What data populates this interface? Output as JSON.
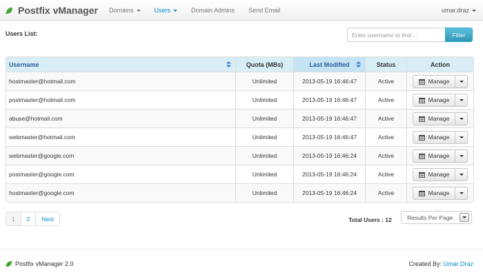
{
  "navbar": {
    "brand": "Postfix vManager",
    "items": [
      {
        "label": "Domains",
        "dropdown": true,
        "active": false
      },
      {
        "label": "Users",
        "dropdown": true,
        "active": true
      },
      {
        "label": "Domain Admins",
        "dropdown": false,
        "active": false
      },
      {
        "label": "Send Email",
        "dropdown": false,
        "active": false
      }
    ],
    "user": "umar.draz"
  },
  "list_title": "Users List:",
  "search": {
    "placeholder": "Enter username to find ...",
    "value": "",
    "button_label": "Filter"
  },
  "table": {
    "columns": [
      "Username",
      "Quota (MBs)",
      "Last Modified",
      "Status",
      "Action"
    ],
    "rows": [
      {
        "username": "hostmaster@hotmail.com",
        "quota": "Unlimited",
        "modified": "2013-05-19 16:46:47",
        "status": "Active",
        "action": "Manage"
      },
      {
        "username": "postmaster@hotmail.com",
        "quota": "Unlimited",
        "modified": "2013-05-19 16:46:47",
        "status": "Active",
        "action": "Manage"
      },
      {
        "username": "abuse@hotmail.com",
        "quota": "Unlimited",
        "modified": "2013-05-19 16:46:47",
        "status": "Active",
        "action": "Manage"
      },
      {
        "username": "webmaster@hotmail.com",
        "quota": "Unlimited",
        "modified": "2013-05-19 16:46:47",
        "status": "Active",
        "action": "Manage"
      },
      {
        "username": "webmaster@google.com",
        "quota": "Unlimited",
        "modified": "2013-05-19 16:46:24",
        "status": "Active",
        "action": "Manage"
      },
      {
        "username": "postmaster@google.com",
        "quota": "Unlimited",
        "modified": "2013-05-19 16:46:24",
        "status": "Active",
        "action": "Manage"
      },
      {
        "username": "hostmaster@google.com",
        "quota": "Unlimited",
        "modified": "2013-05-19 16:46:24",
        "status": "Active",
        "action": "Manage"
      }
    ]
  },
  "pagination": {
    "pages": [
      "1",
      "2"
    ],
    "current": "1",
    "next": "Next"
  },
  "total_users": "Total Users : 12",
  "per_page": {
    "selected": "Results Per Page"
  },
  "footer": {
    "left": "Postfix vManager 2.0",
    "right_prefix": "Created By:",
    "right_link": "Umar Draz"
  },
  "colors": {
    "accent": "#0088cc",
    "table_header": "#d9edf7",
    "filter_button": "#49afcd",
    "leaf": "#4caf3a"
  },
  "icons": {
    "brand": "leaf-icon",
    "manage": "calendar-icon",
    "sort": "sort-arrows-icon",
    "dropdown": "caret-down-icon"
  }
}
